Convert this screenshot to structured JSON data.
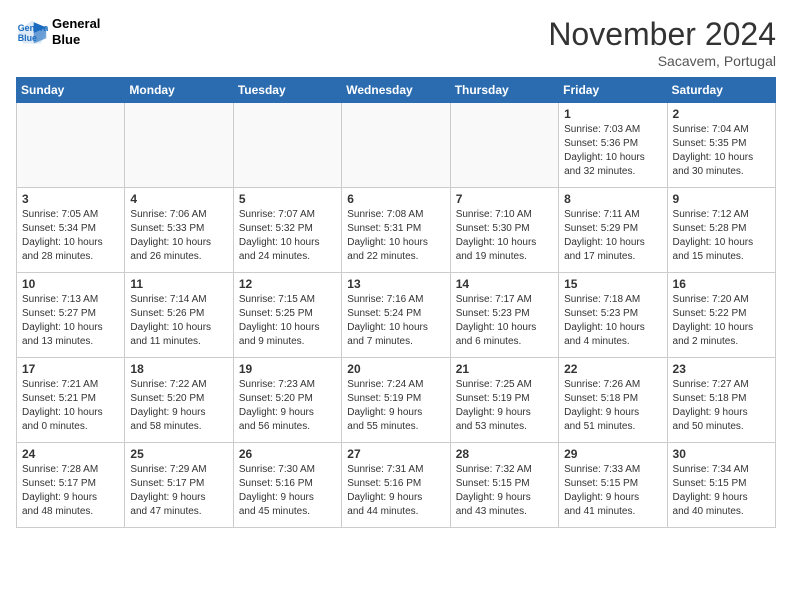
{
  "header": {
    "logo_line1": "General",
    "logo_line2": "Blue",
    "month": "November 2024",
    "location": "Sacavem, Portugal"
  },
  "days_of_week": [
    "Sunday",
    "Monday",
    "Tuesday",
    "Wednesday",
    "Thursday",
    "Friday",
    "Saturday"
  ],
  "weeks": [
    [
      {
        "day": "",
        "info": ""
      },
      {
        "day": "",
        "info": ""
      },
      {
        "day": "",
        "info": ""
      },
      {
        "day": "",
        "info": ""
      },
      {
        "day": "",
        "info": ""
      },
      {
        "day": "1",
        "info": "Sunrise: 7:03 AM\nSunset: 5:36 PM\nDaylight: 10 hours\nand 32 minutes."
      },
      {
        "day": "2",
        "info": "Sunrise: 7:04 AM\nSunset: 5:35 PM\nDaylight: 10 hours\nand 30 minutes."
      }
    ],
    [
      {
        "day": "3",
        "info": "Sunrise: 7:05 AM\nSunset: 5:34 PM\nDaylight: 10 hours\nand 28 minutes."
      },
      {
        "day": "4",
        "info": "Sunrise: 7:06 AM\nSunset: 5:33 PM\nDaylight: 10 hours\nand 26 minutes."
      },
      {
        "day": "5",
        "info": "Sunrise: 7:07 AM\nSunset: 5:32 PM\nDaylight: 10 hours\nand 24 minutes."
      },
      {
        "day": "6",
        "info": "Sunrise: 7:08 AM\nSunset: 5:31 PM\nDaylight: 10 hours\nand 22 minutes."
      },
      {
        "day": "7",
        "info": "Sunrise: 7:10 AM\nSunset: 5:30 PM\nDaylight: 10 hours\nand 19 minutes."
      },
      {
        "day": "8",
        "info": "Sunrise: 7:11 AM\nSunset: 5:29 PM\nDaylight: 10 hours\nand 17 minutes."
      },
      {
        "day": "9",
        "info": "Sunrise: 7:12 AM\nSunset: 5:28 PM\nDaylight: 10 hours\nand 15 minutes."
      }
    ],
    [
      {
        "day": "10",
        "info": "Sunrise: 7:13 AM\nSunset: 5:27 PM\nDaylight: 10 hours\nand 13 minutes."
      },
      {
        "day": "11",
        "info": "Sunrise: 7:14 AM\nSunset: 5:26 PM\nDaylight: 10 hours\nand 11 minutes."
      },
      {
        "day": "12",
        "info": "Sunrise: 7:15 AM\nSunset: 5:25 PM\nDaylight: 10 hours\nand 9 minutes."
      },
      {
        "day": "13",
        "info": "Sunrise: 7:16 AM\nSunset: 5:24 PM\nDaylight: 10 hours\nand 7 minutes."
      },
      {
        "day": "14",
        "info": "Sunrise: 7:17 AM\nSunset: 5:23 PM\nDaylight: 10 hours\nand 6 minutes."
      },
      {
        "day": "15",
        "info": "Sunrise: 7:18 AM\nSunset: 5:23 PM\nDaylight: 10 hours\nand 4 minutes."
      },
      {
        "day": "16",
        "info": "Sunrise: 7:20 AM\nSunset: 5:22 PM\nDaylight: 10 hours\nand 2 minutes."
      }
    ],
    [
      {
        "day": "17",
        "info": "Sunrise: 7:21 AM\nSunset: 5:21 PM\nDaylight: 10 hours\nand 0 minutes."
      },
      {
        "day": "18",
        "info": "Sunrise: 7:22 AM\nSunset: 5:20 PM\nDaylight: 9 hours\nand 58 minutes."
      },
      {
        "day": "19",
        "info": "Sunrise: 7:23 AM\nSunset: 5:20 PM\nDaylight: 9 hours\nand 56 minutes."
      },
      {
        "day": "20",
        "info": "Sunrise: 7:24 AM\nSunset: 5:19 PM\nDaylight: 9 hours\nand 55 minutes."
      },
      {
        "day": "21",
        "info": "Sunrise: 7:25 AM\nSunset: 5:19 PM\nDaylight: 9 hours\nand 53 minutes."
      },
      {
        "day": "22",
        "info": "Sunrise: 7:26 AM\nSunset: 5:18 PM\nDaylight: 9 hours\nand 51 minutes."
      },
      {
        "day": "23",
        "info": "Sunrise: 7:27 AM\nSunset: 5:18 PM\nDaylight: 9 hours\nand 50 minutes."
      }
    ],
    [
      {
        "day": "24",
        "info": "Sunrise: 7:28 AM\nSunset: 5:17 PM\nDaylight: 9 hours\nand 48 minutes."
      },
      {
        "day": "25",
        "info": "Sunrise: 7:29 AM\nSunset: 5:17 PM\nDaylight: 9 hours\nand 47 minutes."
      },
      {
        "day": "26",
        "info": "Sunrise: 7:30 AM\nSunset: 5:16 PM\nDaylight: 9 hours\nand 45 minutes."
      },
      {
        "day": "27",
        "info": "Sunrise: 7:31 AM\nSunset: 5:16 PM\nDaylight: 9 hours\nand 44 minutes."
      },
      {
        "day": "28",
        "info": "Sunrise: 7:32 AM\nSunset: 5:15 PM\nDaylight: 9 hours\nand 43 minutes."
      },
      {
        "day": "29",
        "info": "Sunrise: 7:33 AM\nSunset: 5:15 PM\nDaylight: 9 hours\nand 41 minutes."
      },
      {
        "day": "30",
        "info": "Sunrise: 7:34 AM\nSunset: 5:15 PM\nDaylight: 9 hours\nand 40 minutes."
      }
    ]
  ]
}
